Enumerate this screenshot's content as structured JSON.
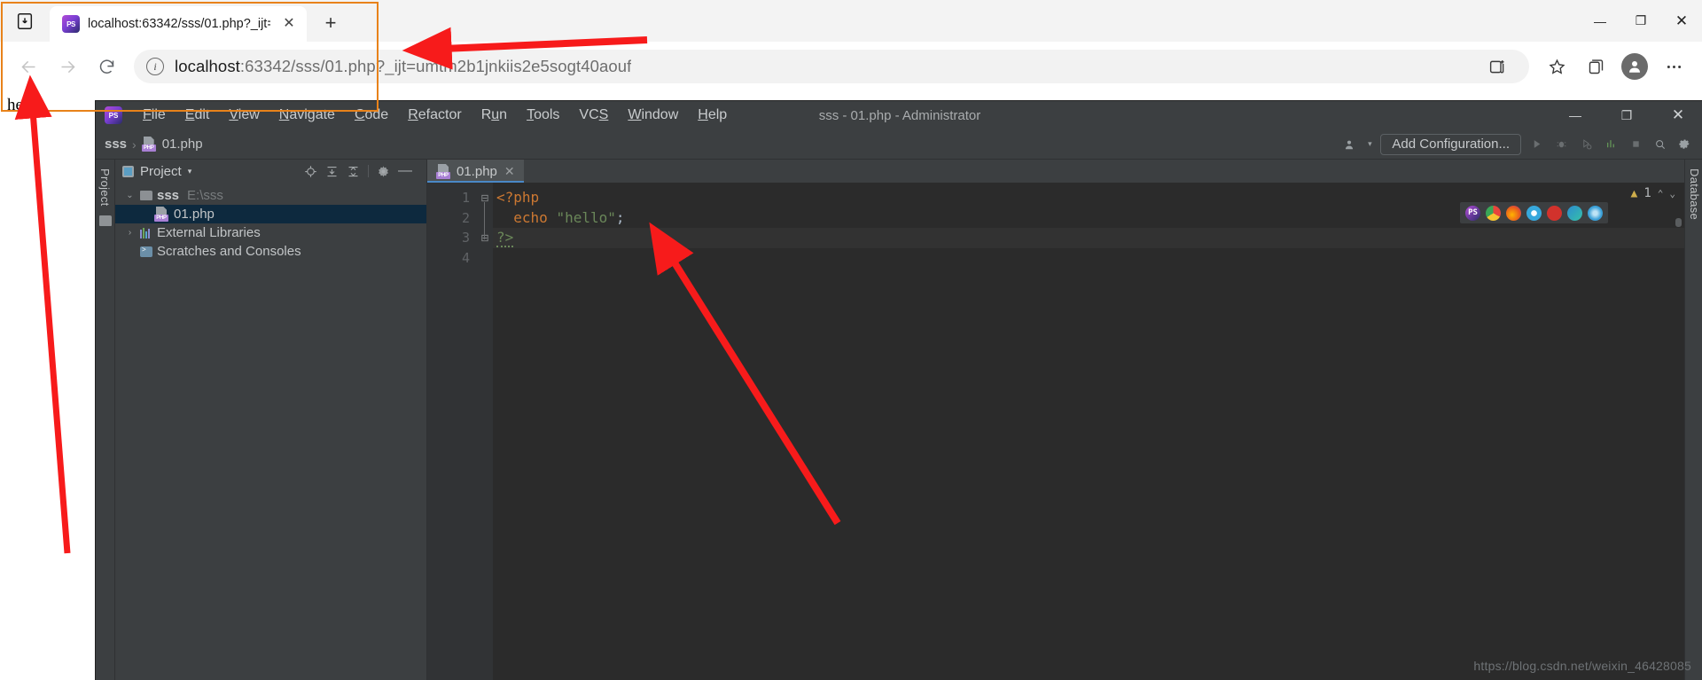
{
  "browser": {
    "system_icon": "reading-list-icon",
    "tab": {
      "favicon": "PS",
      "title": "localhost:63342/sss/01.php?_ijt=",
      "close_label": "✕"
    },
    "new_tab_label": "+",
    "window_controls": {
      "minimize": "—",
      "maximize": "❐",
      "close": "✕"
    },
    "nav": {
      "back_label": "←",
      "forward_label": "→",
      "reload_label": "↻",
      "info_label": "i"
    },
    "url": {
      "full": "localhost:63342/sss/01.php?_ijt=umtm2b1jnkiis2e5sogt40aouf",
      "host": "localhost",
      "rest": ":63342/sss/01.php?_ijt=umtm2b1jnkiis2e5sogt40aouf"
    },
    "actions": {
      "collections_icon": "collections-icon",
      "favorites_icon": "star-icon",
      "split_icon": "split-screen-icon",
      "profile_icon": "profile-avatar-icon",
      "settings_icon": "ellipsis-icon"
    },
    "page_output": "hello"
  },
  "ide": {
    "logo": "PS",
    "title": "sss - 01.php - Administrator",
    "menu": [
      {
        "pre": "",
        "key": "F",
        "post": "ile"
      },
      {
        "pre": "",
        "key": "E",
        "post": "dit"
      },
      {
        "pre": "",
        "key": "V",
        "post": "iew"
      },
      {
        "pre": "",
        "key": "N",
        "post": "avigate"
      },
      {
        "pre": "",
        "key": "C",
        "post": "ode"
      },
      {
        "pre": "",
        "key": "R",
        "post": "efactor"
      },
      {
        "pre": "R",
        "key": "u",
        "post": "n"
      },
      {
        "pre": "",
        "key": "T",
        "post": "ools"
      },
      {
        "pre": "VC",
        "key": "S",
        "post": ""
      },
      {
        "pre": "",
        "key": "W",
        "post": "indow"
      },
      {
        "pre": "",
        "key": "H",
        "post": "elp"
      }
    ],
    "window_controls": {
      "minimize": "—",
      "maximize": "❐",
      "close": "✕"
    },
    "toolbar": {
      "breadcrumb_project": "sss",
      "breadcrumb_sep": "›",
      "breadcrumb_file": "01.php",
      "user_icon": "user-icon",
      "user_caret": "▾",
      "add_configuration": "Add Configuration...",
      "run_icon": "run-icon",
      "debug_icon": "debug-icon",
      "coverage_icon": "coverage-icon",
      "profile_icon": "profile-run-icon",
      "stop_icon": "stop-icon",
      "search_icon": "search-icon",
      "settings_icon": "gear-icon"
    },
    "left_rail_label": "Project",
    "right_rail_label": "Database",
    "project_panel": {
      "title": "Project",
      "caret": "▾",
      "actions": {
        "locate_icon": "locate-target-icon",
        "expand_icon": "expand-all-icon",
        "collapse_icon": "collapse-all-icon",
        "settings_icon": "gear-icon",
        "hide_icon": "hide-panel-icon"
      },
      "tree": [
        {
          "indent": 0,
          "twisty": "⌄",
          "icon": "folder-icon",
          "label": "sss",
          "bold": true,
          "sub": "E:\\sss",
          "selected": false
        },
        {
          "indent": 1,
          "twisty": "",
          "icon": "php-file-icon",
          "label": "01.php",
          "bold": false,
          "sub": "",
          "selected": true
        },
        {
          "indent": 0,
          "twisty": "›",
          "icon": "libraries-icon",
          "label": "External Libraries",
          "bold": false,
          "sub": "",
          "selected": false
        },
        {
          "indent": 0,
          "twisty": "",
          "icon": "scratches-icon",
          "label": "Scratches and Consoles",
          "bold": false,
          "sub": "",
          "selected": false
        }
      ]
    },
    "editor": {
      "tab": {
        "icon": "php-file-icon",
        "label": "01.php",
        "close": "✕"
      },
      "lines": [
        {
          "num": "1",
          "fold": "⊟",
          "tokens": [
            {
              "t": "<?php",
              "c": "k-tag"
            }
          ]
        },
        {
          "num": "2",
          "fold": "",
          "tokens": [
            {
              "t": "  ",
              "c": "k-pun"
            },
            {
              "t": "echo",
              "c": "k-kw"
            },
            {
              "t": " ",
              "c": "k-pun"
            },
            {
              "t": "\"hello\"",
              "c": "k-str"
            },
            {
              "t": ";",
              "c": "k-pun"
            }
          ]
        },
        {
          "num": "3",
          "fold": "⊟",
          "tokens": [
            {
              "t": "?>",
              "c": "k-str squig"
            }
          ]
        },
        {
          "num": "4",
          "fold": "",
          "tokens": []
        }
      ],
      "warning_icon": "warning-triangle-icon",
      "warning_count": "1",
      "warn_up": "⌃",
      "warn_down": "⌄",
      "browser_icons": [
        {
          "name": "phpstorm-browser-icon",
          "glyph": "PS",
          "color": "#7b3fd4"
        },
        {
          "name": "chrome-browser-icon",
          "glyph": "",
          "color": "#e8a33d"
        },
        {
          "name": "firefox-browser-icon",
          "glyph": "",
          "color": "#e06c2a"
        },
        {
          "name": "safari-browser-icon",
          "glyph": "",
          "color": "#3aa6d8"
        },
        {
          "name": "opera-browser-icon",
          "glyph": "",
          "color": "#d2322c"
        },
        {
          "name": "edge-browser-icon",
          "glyph": "",
          "color": "#2d8cd0"
        },
        {
          "name": "ie-browser-icon",
          "glyph": "",
          "color": "#4aa3d8"
        }
      ]
    },
    "watermark": "https://blog.csdn.net/weixin_46428085"
  },
  "annotations": {
    "highlight_color": "#e8821a",
    "arrow_color": "#f71b1b",
    "arrows": [
      {
        "name": "arrow-to-hello-output",
        "desc": "long arrow pointing up to the hello output text"
      },
      {
        "name": "arrow-to-url",
        "desc": "horizontal arrow pointing left at address bar URL"
      },
      {
        "name": "arrow-to-code",
        "desc": "arrow pointing up-left at the php code block"
      }
    ]
  }
}
